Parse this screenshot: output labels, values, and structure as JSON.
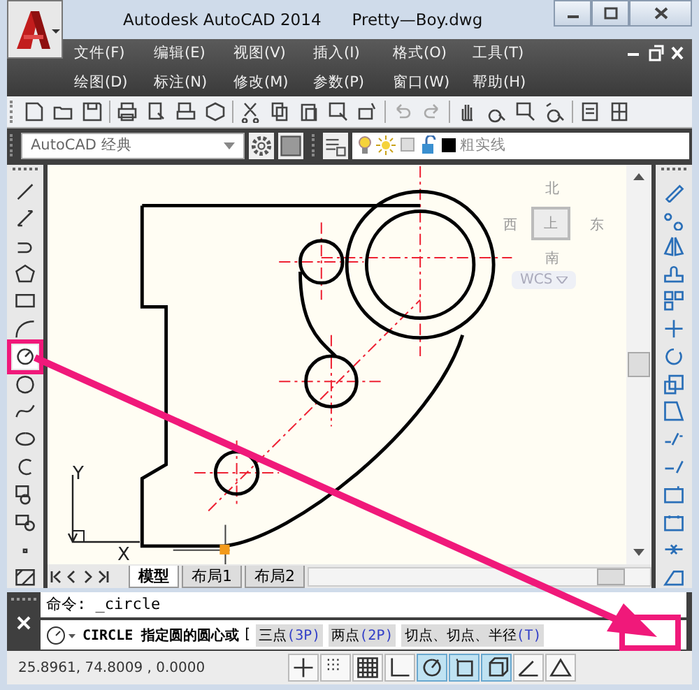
{
  "window": {
    "title": "Autodesk AutoCAD 2014",
    "file": "Pretty—Boy.dwg"
  },
  "menu_rows": [
    [
      "文件(F)",
      "编辑(E)",
      "视图(V)",
      "插入(I)",
      "格式(O)",
      "工具(T)"
    ],
    [
      "绘图(D)",
      "标注(N)",
      "修改(M)",
      "参数(P)",
      "窗口(W)",
      "帮助(H)"
    ]
  ],
  "workspace": {
    "value": "AutoCAD 经典"
  },
  "linetype": {
    "value": "粗实线"
  },
  "left_tools": [
    {
      "highlighted": false
    },
    {
      "highlighted": false
    },
    {
      "highlighted": false
    },
    {
      "highlighted": false
    },
    {
      "highlighted": false
    },
    {
      "highlighted": false
    },
    {
      "highlighted": true
    },
    {
      "highlighted": false
    },
    {
      "highlighted": false
    },
    {
      "highlighted": false
    },
    {
      "highlighted": false
    },
    {
      "highlighted": false
    },
    {
      "highlighted": false
    },
    {
      "highlighted": false
    },
    {
      "highlighted": false
    }
  ],
  "viewcube": {
    "top": "上",
    "north": "北",
    "south": "南",
    "east": "东",
    "west": "西",
    "ucs": "WCS"
  },
  "ucs_axes": {
    "y": "Y",
    "x": "X"
  },
  "layout_tabs": [
    {
      "label": "模型",
      "selected": true
    },
    {
      "label": "布局1",
      "selected": false
    },
    {
      "label": "布局2",
      "selected": false
    }
  ],
  "command": {
    "history": "命令:  _circle",
    "prompt": "CIRCLE 指定圆的圆心或",
    "bracket": "[",
    "options": [
      {
        "label": "三点",
        "key": "(3P)"
      },
      {
        "label": "两点",
        "key": "(2P)"
      },
      {
        "label": "切点、切点、半径",
        "key": "(T)"
      }
    ]
  },
  "status_bar": {
    "coordinates": "25.8961,  74.8009 , 0.0000",
    "toggles": [
      {
        "on": false
      },
      {
        "on": false
      },
      {
        "on": false
      },
      {
        "on": false
      },
      {
        "on": true
      },
      {
        "on": true
      },
      {
        "on": true
      },
      {
        "on": false
      },
      {
        "on": false
      }
    ]
  }
}
